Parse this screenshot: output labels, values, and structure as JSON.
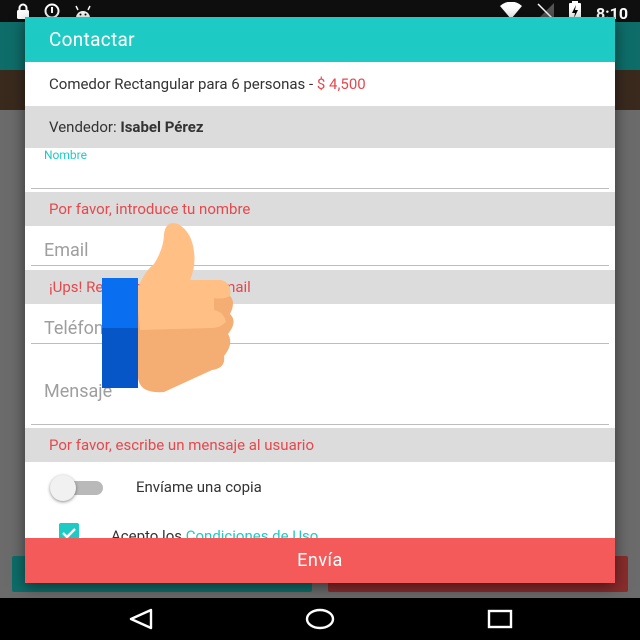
{
  "status_bar": {
    "time": "8:10",
    "left_icons": [
      "lock-icon",
      "info-circle-icon",
      "android-icon"
    ],
    "right_icons": [
      "wifi-icon",
      "no-signal-icon",
      "battery-charging-icon"
    ]
  },
  "dialog": {
    "title": "Contactar",
    "product": {
      "name": "Comedor Rectangular para 6 personas - ",
      "price": "$ 4,500"
    },
    "seller": {
      "label": "Vendedor: ",
      "name": "Isabel Pérez"
    },
    "fields": {
      "nombre": {
        "label": "Nombre",
        "value": ""
      },
      "email": {
        "placeholder": "Email"
      },
      "telefono": {
        "placeholder": "Teléfono"
      },
      "mensaje": {
        "placeholder": "Mensaje"
      }
    },
    "errors": {
      "nombre": "Por favor, introduce tu nombre",
      "email": "¡Ups! Revisa por favor tu email",
      "mensaje": "Por favor, escribe un mensaje al usuario"
    },
    "copy_toggle": {
      "label": "Envíame una copia",
      "on": false
    },
    "terms": {
      "prefix": "Acepto los ",
      "link": "Condiciones de Uso",
      "checked": true
    },
    "send_label": "Envía"
  },
  "colors": {
    "accent": "#1ecbc4",
    "error": "#e5484d",
    "send_button": "#f45a5a",
    "error_row_bg": "#dcdcdc"
  }
}
